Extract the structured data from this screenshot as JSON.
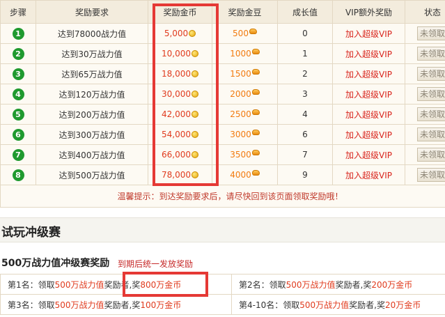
{
  "table": {
    "headers": [
      "步骤",
      "奖励要求",
      "奖励金币",
      "奖励金豆",
      "成长值",
      "VIP额外奖励",
      "状态"
    ],
    "rows": [
      {
        "step": "1",
        "requirement": "达到78000战力值",
        "gold": "5,000",
        "beans": "500",
        "growth": "0",
        "vip": "加入超级VIP",
        "status": "未领取"
      },
      {
        "step": "2",
        "requirement": "达到30万战力值",
        "gold": "10,000",
        "beans": "1000",
        "growth": "1",
        "vip": "加入超级VIP",
        "status": "未领取"
      },
      {
        "step": "3",
        "requirement": "达到65万战力值",
        "gold": "18,000",
        "beans": "1500",
        "growth": "2",
        "vip": "加入超级VIP",
        "status": "未领取"
      },
      {
        "step": "4",
        "requirement": "达到120万战力值",
        "gold": "30,000",
        "beans": "2000",
        "growth": "3",
        "vip": "加入超级VIP",
        "status": "未领取"
      },
      {
        "step": "5",
        "requirement": "达到200万战力值",
        "gold": "42,000",
        "beans": "2500",
        "growth": "4",
        "vip": "加入超级VIP",
        "status": "未领取"
      },
      {
        "step": "6",
        "requirement": "达到300万战力值",
        "gold": "54,000",
        "beans": "3000",
        "growth": "6",
        "vip": "加入超级VIP",
        "status": "未领取"
      },
      {
        "step": "7",
        "requirement": "达到400万战力值",
        "gold": "66,000",
        "beans": "3500",
        "growth": "7",
        "vip": "加入超级VIP",
        "status": "未领取"
      },
      {
        "step": "8",
        "requirement": "达到500万战力值",
        "gold": "78,000",
        "beans": "4000",
        "growth": "9",
        "vip": "加入超级VIP",
        "status": "未领取"
      }
    ],
    "tip": "温馨提示：到达奖励要求后，请尽快回到该页面领取奖励哦！"
  },
  "section": {
    "title": "试玩冲级赛"
  },
  "league": {
    "title": "500万战力值冲级赛奖励",
    "note": "到期后统一发放奖励",
    "prizes": [
      {
        "prefix": "第1名：领取",
        "mid": "500万战力值",
        "mid2": "奖励者,奖",
        "amount": "800万金币"
      },
      {
        "prefix": "第2名：领取",
        "mid": "500万战力值",
        "mid2": "奖励者,奖",
        "amount": "200万金币"
      },
      {
        "prefix": "第3名：领取",
        "mid": "500万战力值",
        "mid2": "奖励者,奖",
        "amount": "100万金币"
      },
      {
        "prefix": "第4-10名：领取",
        "mid": "500万战力值",
        "mid2": "奖励者,奖",
        "amount": "20万金币"
      }
    ]
  },
  "colors": {
    "accent_red": "#e03b1e",
    "step_green": "#1f9a2f",
    "highlight_border": "#e53935",
    "header_bg": "#f3ecdd"
  },
  "icons": {
    "gold": "gold-coin-icon",
    "bean": "gold-bean-icon"
  }
}
